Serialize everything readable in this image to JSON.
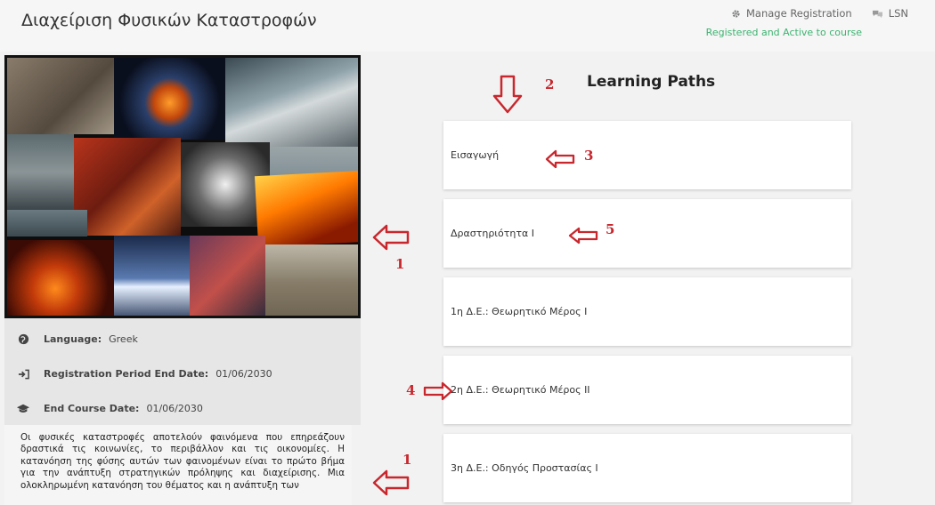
{
  "course": {
    "title": "Διαχείριση Φυσικών Καταστροφών"
  },
  "header": {
    "manage_registration": "Manage Registration",
    "lsn": "LSN",
    "status": "Registered and Active to course"
  },
  "info": {
    "language_label": "Language:",
    "language_value": "Greek",
    "registration_label": "Registration Period End Date:",
    "registration_value": "01/06/2030",
    "end_label": "End Course Date:",
    "end_value": "01/06/2030"
  },
  "description": "Οι φυσικές καταστροφές αποτελούν φαινόμενα που επηρεάζουν δραστικά τις κοινωνίες, το περιβάλλον και τις οικονομίες. Η κατανόηση της φύσης αυτών των φαινομένων είναι το πρώτο βήμα για την ανάπτυξη στρατηγικών πρόληψης και διαχείρισης. Μια ολοκληρωμένη κατανόηση του θέματος και η ανάπτυξη των",
  "learning_paths": {
    "title": "Learning Paths",
    "items": [
      "Εισαγωγή",
      "Δραστηριότητα Ι",
      "1η Δ.Ε.: Θεωρητικό Μέρος Ι",
      "2η Δ.Ε.: Θεωρητικό Μέρος ΙΙ",
      "3η Δ.Ε.: Οδηγός Προστασίας Ι"
    ]
  },
  "annotations": {
    "n1a": "1",
    "n1b": "1",
    "n2": "2",
    "n3": "3",
    "n4": "4",
    "n5": "5"
  }
}
